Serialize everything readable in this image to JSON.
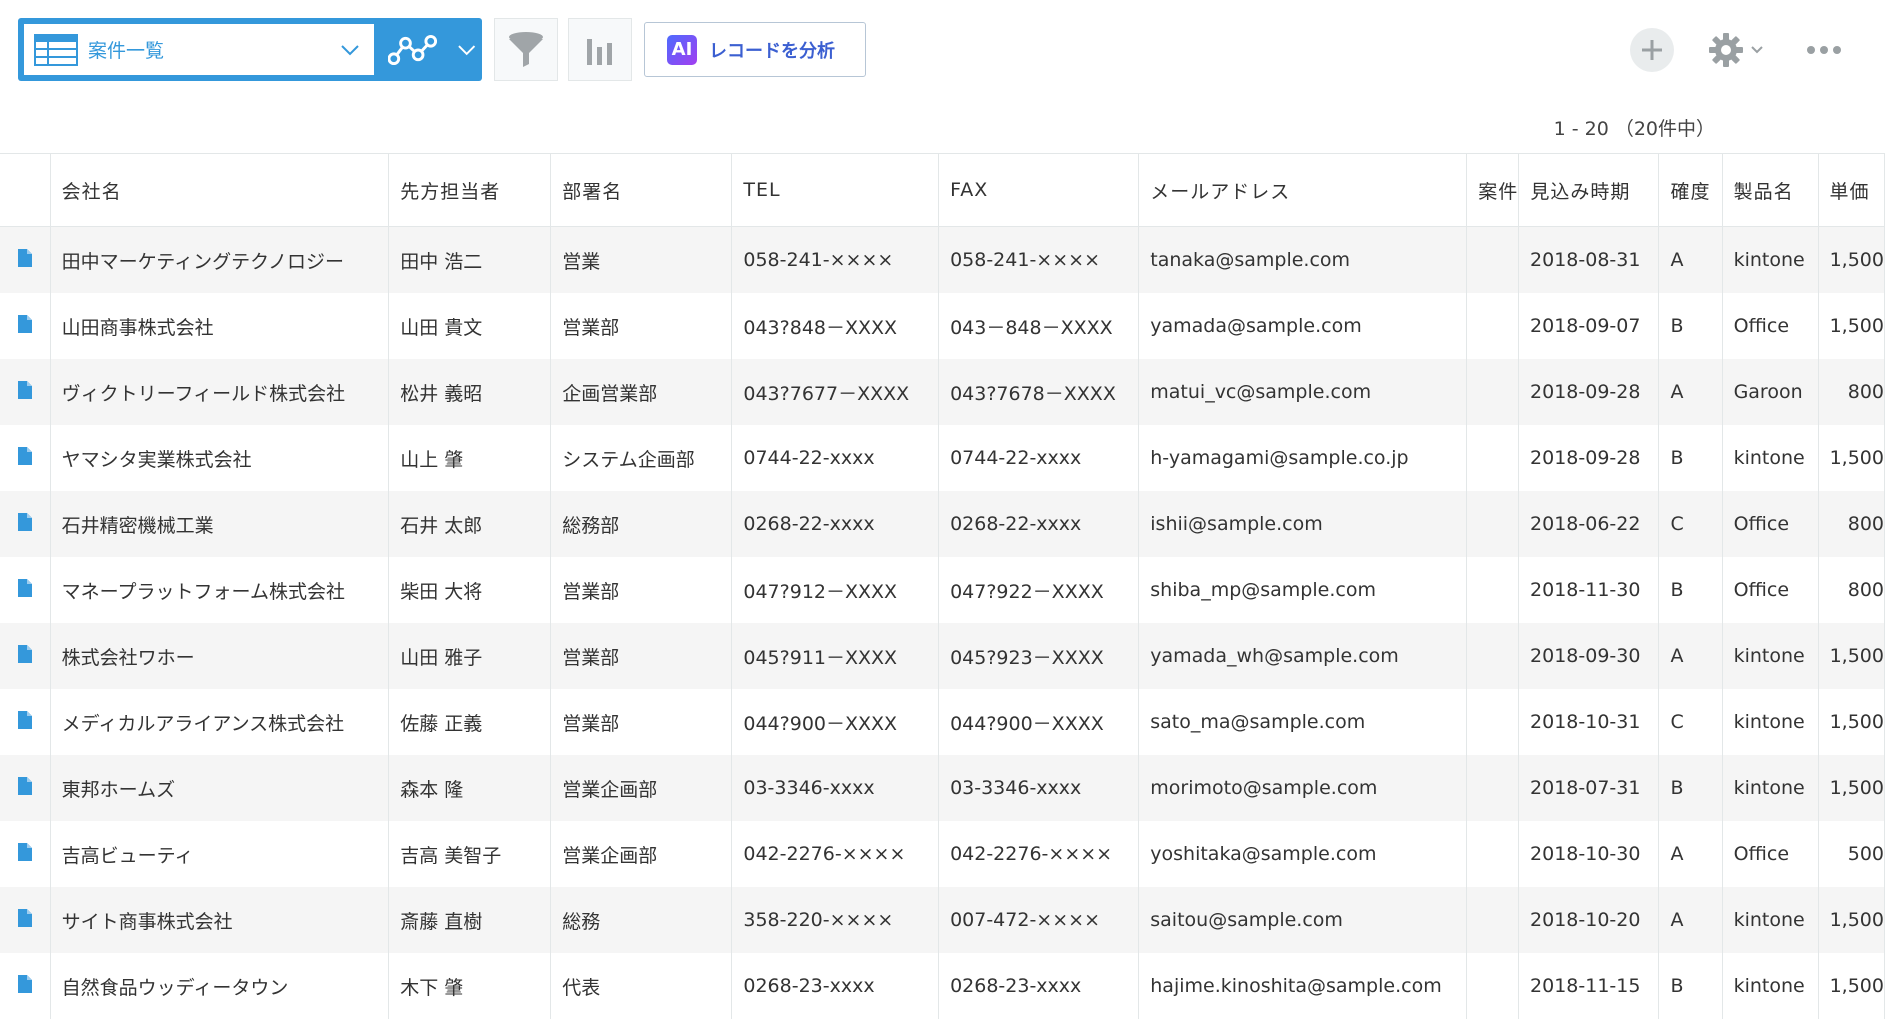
{
  "toolbar": {
    "view_name": "案件一覧",
    "ai_label": "レコードを分析",
    "ai_badge": "AI"
  },
  "pager": {
    "text": "1 - 20 （20件中）"
  },
  "table": {
    "headers": [
      "会社名",
      "先方担当者",
      "部署名",
      "TEL",
      "FAX",
      "メールアドレス",
      "案件",
      "見込み時期",
      "確度",
      "製品名",
      "単価"
    ],
    "rows": [
      {
        "company": "田中マーケティングテクノロジー",
        "contact": "田中 浩二",
        "dept": "営業",
        "tel": "058-241-××××",
        "fax": "058-241-××××",
        "email": "tanaka@sample.com",
        "case": "",
        "date": "2018-08-31",
        "rank": "A",
        "product": "kintone",
        "price": "1,500"
      },
      {
        "company": "山田商事株式会社",
        "contact": "山田 貴文",
        "dept": "営業部",
        "tel": "043?848－XXXX",
        "fax": "043－848－XXXX",
        "email": "yamada@sample.com",
        "case": "",
        "date": "2018-09-07",
        "rank": "B",
        "product": "Office",
        "price": "1,500"
      },
      {
        "company": "ヴィクトリーフィールド株式会社",
        "contact": "松井 義昭",
        "dept": "企画営業部",
        "tel": "043?7677－XXXX",
        "fax": "043?7678－XXXX",
        "email": "matui_vc@sample.com",
        "case": "",
        "date": "2018-09-28",
        "rank": "A",
        "product": "Garoon",
        "price": "800"
      },
      {
        "company": "ヤマシタ実業株式会社",
        "contact": "山上 肇",
        "dept": "システム企画部",
        "tel": "0744-22-xxxx",
        "fax": "0744-22-xxxx",
        "email": "h-yamagami@sample.co.jp",
        "case": "",
        "date": "2018-09-28",
        "rank": "B",
        "product": "kintone",
        "price": "1,500"
      },
      {
        "company": "石井精密機械工業",
        "contact": "石井 太郎",
        "dept": "総務部",
        "tel": "0268-22-xxxx",
        "fax": "0268-22-xxxx",
        "email": "ishii@sample.com",
        "case": "",
        "date": "2018-06-22",
        "rank": "C",
        "product": "Office",
        "price": "800"
      },
      {
        "company": "マネープラットフォーム株式会社",
        "contact": "柴田 大将",
        "dept": "営業部",
        "tel": "047?912－XXXX",
        "fax": "047?922－XXXX",
        "email": "shiba_mp@sample.com",
        "case": "",
        "date": "2018-11-30",
        "rank": "B",
        "product": "Office",
        "price": "800"
      },
      {
        "company": "株式会社ワホー",
        "contact": "山田 雅子",
        "dept": "営業部",
        "tel": "045?911－XXXX",
        "fax": "045?923－XXXX",
        "email": "yamada_wh@sample.com",
        "case": "",
        "date": "2018-09-30",
        "rank": "A",
        "product": "kintone",
        "price": "1,500"
      },
      {
        "company": "メディカルアライアンス株式会社",
        "contact": "佐藤 正義",
        "dept": "営業部",
        "tel": "044?900－XXXX",
        "fax": "044?900－XXXX",
        "email": "sato_ma@sample.com",
        "case": "",
        "date": "2018-10-31",
        "rank": "C",
        "product": "kintone",
        "price": "1,500"
      },
      {
        "company": "東邦ホームズ",
        "contact": "森本 隆",
        "dept": "営業企画部",
        "tel": "03-3346-xxxx",
        "fax": "03-3346-xxxx",
        "email": "morimoto@sample.com",
        "case": "",
        "date": "2018-07-31",
        "rank": "B",
        "product": "kintone",
        "price": "1,500"
      },
      {
        "company": "吉高ビューティ",
        "contact": "吉高 美智子",
        "dept": "営業企画部",
        "tel": "042-2276-××××",
        "fax": "042-2276-××××",
        "email": "yoshitaka@sample.com",
        "case": "",
        "date": "2018-10-30",
        "rank": "A",
        "product": "Office",
        "price": "500"
      },
      {
        "company": "サイト商事株式会社",
        "contact": "斎藤 直樹",
        "dept": "総務",
        "tel": "358-220-××××",
        "fax": "007-472-××××",
        "email": "saitou@sample.com",
        "case": "",
        "date": "2018-10-20",
        "rank": "A",
        "product": "kintone",
        "price": "1,500"
      },
      {
        "company": "自然食品ウッディータウン",
        "contact": "木下 肇",
        "dept": "代表",
        "tel": "0268-23-xxxx",
        "fax": "0268-23-xxxx",
        "email": "hajime.kinoshita@sample.com",
        "case": "",
        "date": "2018-11-15",
        "rank": "B",
        "product": "kintone",
        "price": "1,500"
      }
    ]
  },
  "colors": {
    "accent": "#3498db",
    "row_alt": "#f5f5f5",
    "border": "#e3e7e8",
    "icon_gray": "#a0a5a8"
  },
  "icons": {
    "view": "table-icon",
    "graph": "graph-icon",
    "filter": "filter-icon",
    "chart": "bar-chart-icon",
    "add": "plus-icon",
    "settings": "gear-icon",
    "more": "more-icon",
    "record": "document-icon"
  }
}
